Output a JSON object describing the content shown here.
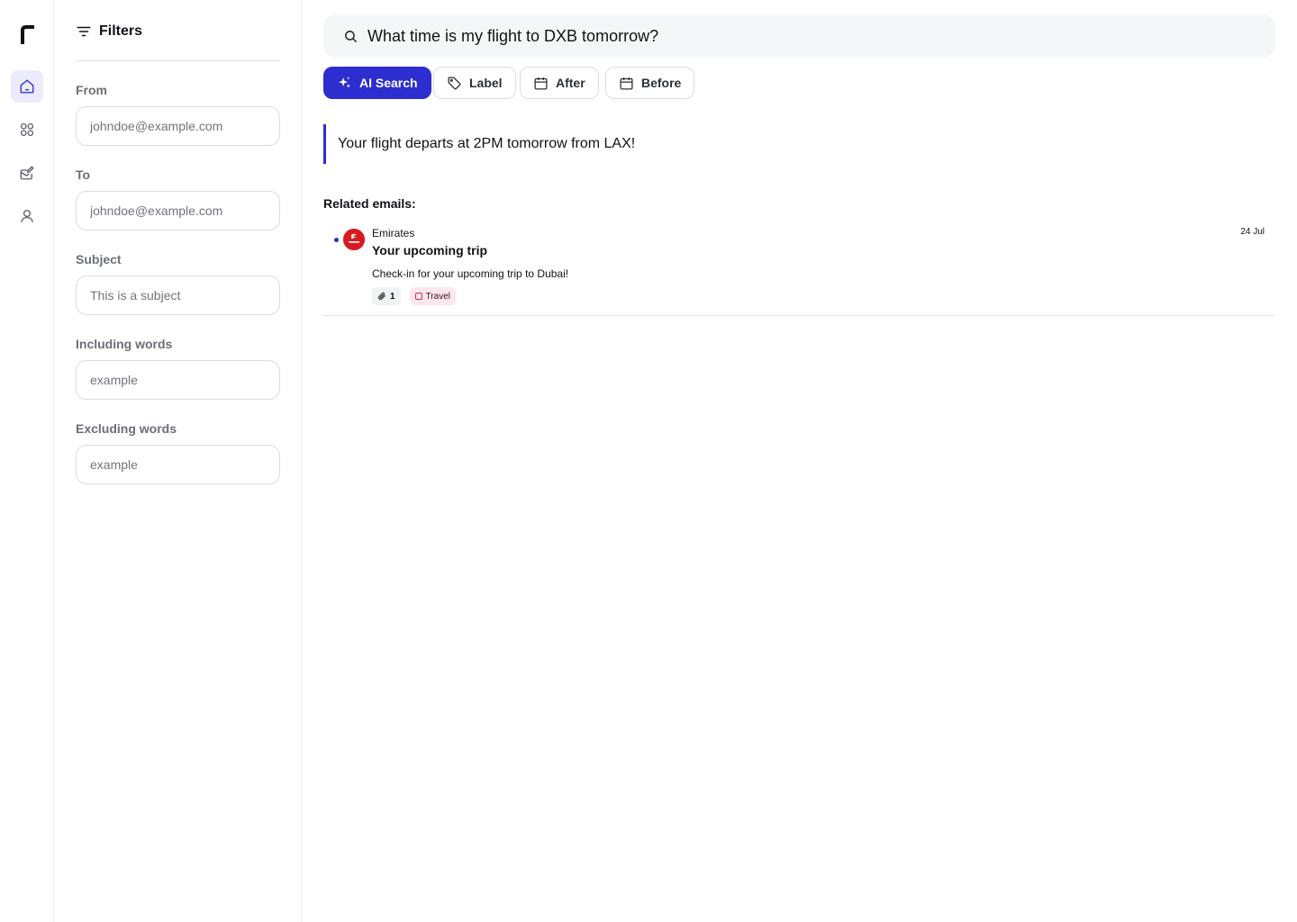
{
  "colors": {
    "accent": "#2c2ed0",
    "active_nav_bg": "#ebebfb",
    "travel_tag_bg": "#fde7ec",
    "emirates_red": "#d71a21"
  },
  "nav": {
    "logo_icon": "brand-logo-icon",
    "items": [
      {
        "icon": "home-icon",
        "active": true
      },
      {
        "icon": "apps-grid-icon",
        "active": false
      },
      {
        "icon": "compose-icon",
        "active": false
      },
      {
        "icon": "user-icon",
        "active": false
      }
    ]
  },
  "filters": {
    "title": "Filters",
    "from": {
      "label": "From",
      "placeholder": "johndoe@example.com",
      "value": ""
    },
    "to": {
      "label": "To",
      "placeholder": "johndoe@example.com",
      "value": ""
    },
    "subject": {
      "label": "Subject",
      "placeholder": "This is a subject",
      "value": ""
    },
    "including": {
      "label": "Including words",
      "placeholder": "example",
      "value": ""
    },
    "excluding": {
      "label": "Excluding words",
      "placeholder": "example",
      "value": ""
    }
  },
  "search": {
    "query": "What time is my flight to DXB tomorrow?"
  },
  "chips": {
    "ai_search": "AI Search",
    "label": "Label",
    "after": "After",
    "before": "Before"
  },
  "answer": "Your flight departs at 2PM tomorrow from LAX!",
  "related": {
    "title": "Related emails:",
    "emails": [
      {
        "sender": "Emirates",
        "subject": "Your upcoming trip",
        "snippet": "Check-in for your upcoming trip to Dubai!",
        "date": "24 Jul",
        "unread": true,
        "attachments": "1",
        "label": "Travel"
      }
    ]
  }
}
